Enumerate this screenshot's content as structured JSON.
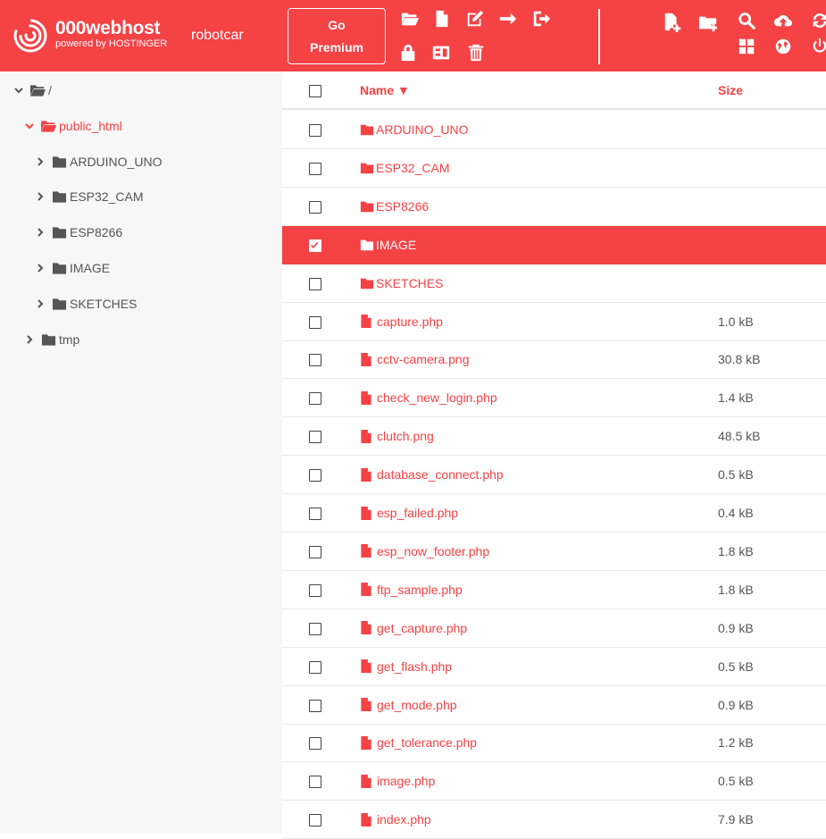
{
  "header": {
    "brand_name": "000webhost",
    "brand_sub": "powered by HOSTINGER",
    "site_name": "robotcar",
    "premium_line1": "Go",
    "premium_line2": "Premium",
    "accent_color": "#f44245",
    "toolbar_icons": [
      "open-folder-icon",
      "file-icon",
      "edit-icon",
      "move-arrow-icon",
      "logout-icon",
      "lock-icon",
      "archive-icon",
      "trash-icon",
      "new-file-icon",
      "new-folder-icon",
      "search-icon",
      "upload-cloud-icon",
      "refresh-icon",
      "grid-view-icon",
      "globe-icon",
      "power-icon"
    ]
  },
  "tree": {
    "root": "/",
    "public_html": "public_html",
    "children": [
      "ARDUINO_UNO",
      "ESP32_CAM",
      "ESP8266",
      "IMAGE",
      "SKETCHES"
    ],
    "tmp": "tmp"
  },
  "list": {
    "col_name": "Name ▼",
    "col_size": "Size",
    "rows": [
      {
        "name": "ARDUINO_UNO",
        "size": "",
        "type": "folder"
      },
      {
        "name": "ESP32_CAM",
        "size": "",
        "type": "folder"
      },
      {
        "name": "ESP8266",
        "size": "",
        "type": "folder"
      },
      {
        "name": "IMAGE",
        "size": "",
        "type": "folder",
        "selected": true
      },
      {
        "name": "SKETCHES",
        "size": "",
        "type": "folder"
      },
      {
        "name": "capture.php",
        "size": "1.0 kB",
        "type": "file"
      },
      {
        "name": "cctv-camera.png",
        "size": "30.8 kB",
        "type": "file"
      },
      {
        "name": "check_new_login.php",
        "size": "1.4 kB",
        "type": "file"
      },
      {
        "name": "clutch.png",
        "size": "48.5 kB",
        "type": "file"
      },
      {
        "name": "database_connect.php",
        "size": "0.5 kB",
        "type": "file"
      },
      {
        "name": "esp_failed.php",
        "size": "0.4 kB",
        "type": "file"
      },
      {
        "name": "esp_now_footer.php",
        "size": "1.8 kB",
        "type": "file"
      },
      {
        "name": "ftp_sample.php",
        "size": "1.8 kB",
        "type": "file"
      },
      {
        "name": "get_capture.php",
        "size": "0.9 kB",
        "type": "file"
      },
      {
        "name": "get_flash.php",
        "size": "0.5 kB",
        "type": "file"
      },
      {
        "name": "get_mode.php",
        "size": "0.9 kB",
        "type": "file"
      },
      {
        "name": "get_tolerance.php",
        "size": "1.2 kB",
        "type": "file"
      },
      {
        "name": "image.php",
        "size": "0.5 kB",
        "type": "file"
      },
      {
        "name": "index.php",
        "size": "7.9 kB",
        "type": "file"
      }
    ]
  }
}
